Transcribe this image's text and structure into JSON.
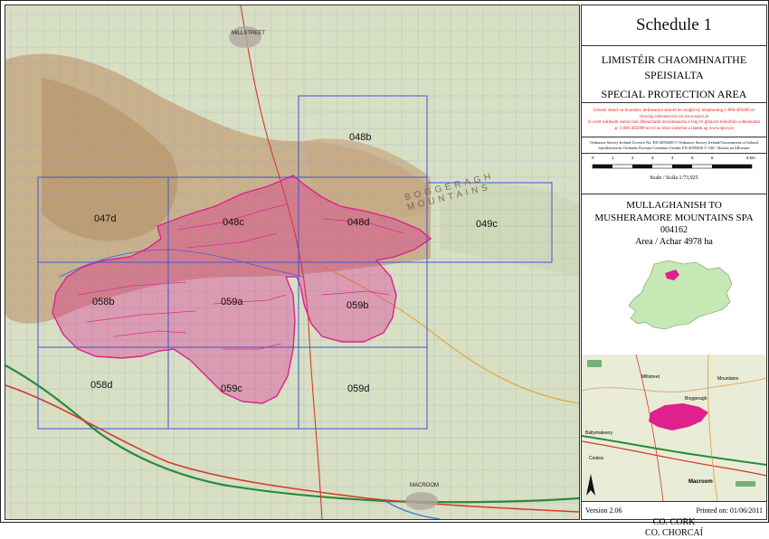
{
  "schedule_title": "Schedule 1",
  "area_name_irish": "LIMISTÉIR CHAOMHNAITHE SPEISIALTA",
  "area_type_english": "SPECIAL PROTECTION AREA",
  "notice_en": "Greater detail on boundary delineation should be sought by telephoning 1-800-405000 or viewing relevant text on www.npws.ie",
  "notice_ga": "Is ceart tuilleadh sonraí faoi dhreachadh teorainneacha a lorg trí ghlaoch teileafóin a dhéanamh ar 1-800-405000 nó trí an téacs iomchuí a léamh ag www.npws.ie",
  "copyright_en": "Ordnance Survey Ireland Licence No. EN 0059208 © Ordnance Survey Ireland/Government of Ireland",
  "copyright_ga": "Suirbhéireacht Ordanáis Éireann Ceadúnas Uimhir EN 0059208 © OSI / Rialtas na hÉireann",
  "scale": {
    "ticks": [
      "0",
      "1",
      "2",
      "3",
      "4",
      "5",
      "6",
      "8 km"
    ],
    "label": "Scale / Scála 1:73,925"
  },
  "spa": {
    "name": "MULLAGHANISH TO MUSHERAMORE MOUNTAINS SPA",
    "code": "004162",
    "area": "Area / Achar 4978 ha"
  },
  "county_en": "CO. CORK",
  "county_ga": "CO. CHORCAÍ",
  "version": "Version 2.06",
  "printed": "Printed on: 01/06/2011",
  "map_sheets": [
    {
      "label": "048b"
    },
    {
      "label": "047d"
    },
    {
      "label": "048c"
    },
    {
      "label": "048d"
    },
    {
      "label": "049c"
    },
    {
      "label": "058b"
    },
    {
      "label": "059a"
    },
    {
      "label": "059b"
    },
    {
      "label": "058d"
    },
    {
      "label": "059c"
    },
    {
      "label": "059d"
    }
  ],
  "map_text": {
    "mountains": "BOGGERAGH MOUNTAINS",
    "town1": "MILLSTREET",
    "town2": "MACROOM"
  },
  "colors": {
    "boundary": "#e0208c",
    "sheet_grid": "#3a55d8",
    "river": "#2a8a3a",
    "road": "#d63a2a",
    "upland": "#c4a27a",
    "lowland": "#d8dfc3",
    "notice": "#dd2222"
  },
  "location_map": {
    "places": [
      "Millstreet",
      "Mountains",
      "Boggeragh",
      "Macroom",
      "Coolea",
      "Ballymakeery"
    ]
  }
}
